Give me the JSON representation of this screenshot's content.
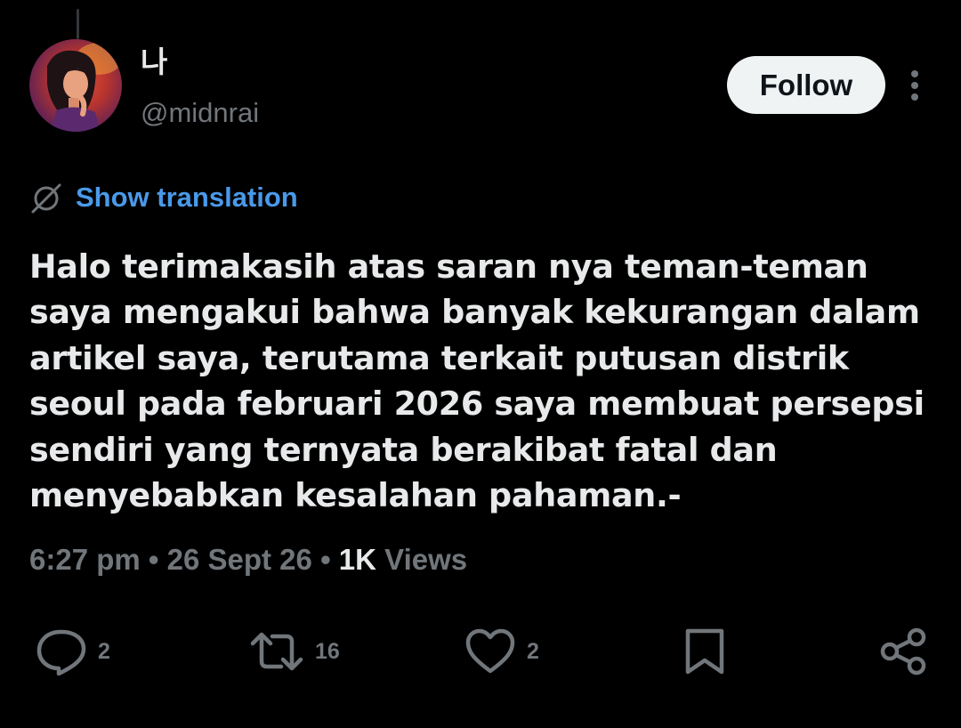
{
  "author": {
    "display_name": "나",
    "handle": "@midnrai",
    "avatar": "avatar-illustration"
  },
  "header": {
    "follow_label": "Follow",
    "more_icon": "more-vertical-icon"
  },
  "translation": {
    "icon": "globe-slash-icon",
    "label": "Show translation"
  },
  "tweet": {
    "lines": [
      "Halo terimakasih atas saran nya teman-teman",
      "saya mengakui bahwa banyak kekurangan dalam",
      "artikel saya, terutama terkait putusan distrik",
      "seoul pada februari 2026 saya membuat persepsi",
      "sendiri yang ternyata berakibat fatal dan",
      "menyebabkan kesalahan pahaman.-"
    ]
  },
  "meta": {
    "time": "6:27 pm",
    "separator": "•",
    "date": "26 Sept 26",
    "views_count": "1K",
    "views_label": "Views"
  },
  "actions": {
    "reply": {
      "icon": "reply-icon",
      "count": "2"
    },
    "retweet": {
      "icon": "retweet-icon",
      "count": "16"
    },
    "like": {
      "icon": "heart-icon",
      "count": "2"
    },
    "bookmark": {
      "icon": "bookmark-icon"
    },
    "share": {
      "icon": "share-icon"
    }
  },
  "colors": {
    "background": "#000000",
    "text_primary": "#e7e9ea",
    "text_secondary": "#71767b",
    "accent_link": "#4a99e9",
    "follow_bg": "#eff3f4"
  }
}
